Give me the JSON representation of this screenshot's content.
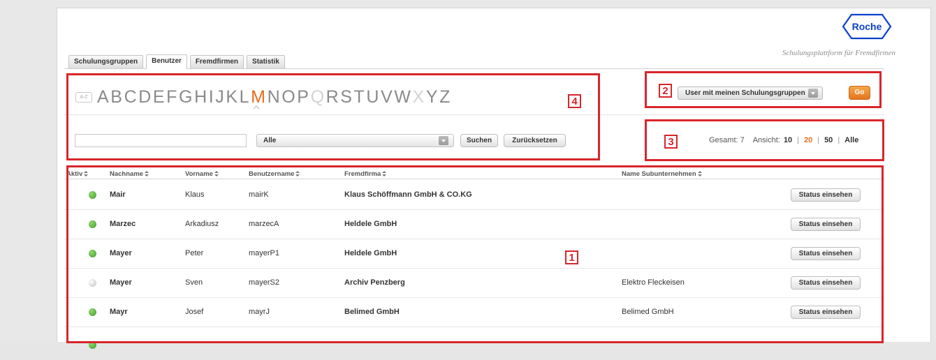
{
  "brand": {
    "logo_text": "Roche",
    "tagline": "Schulungsplattform für Fremdfirmen"
  },
  "tabs": [
    {
      "label": "Schulungsgruppen",
      "active": false
    },
    {
      "label": "Benutzer",
      "active": true
    },
    {
      "label": "Fremdfirmen",
      "active": false
    },
    {
      "label": "Statistik",
      "active": false
    }
  ],
  "alphabet": {
    "icon_label": "A-Z",
    "letters": [
      "A",
      "B",
      "C",
      "D",
      "E",
      "F",
      "G",
      "H",
      "I",
      "J",
      "K",
      "L",
      "M",
      "N",
      "O",
      "P",
      "Q",
      "R",
      "S",
      "T",
      "U",
      "V",
      "W",
      "X",
      "Y",
      "Z"
    ],
    "active": "M",
    "disabled": [
      "Q",
      "X"
    ]
  },
  "search": {
    "input_value": "",
    "filter_selected": "Alle",
    "search_label": "Suchen",
    "reset_label": "Zurücksetzen"
  },
  "user_filter": {
    "selected": "User mit meinen Schulungsgruppen",
    "go_label": "Go"
  },
  "pager": {
    "total_label": "Gesamt:",
    "total": "7",
    "view_label": "Ansicht:",
    "options": [
      "10",
      "20",
      "50",
      "Alle"
    ],
    "selected": "20"
  },
  "table": {
    "headers": [
      "Aktiv",
      "Nachname",
      "Vorname",
      "Benutzername",
      "Fremdfirma",
      "Name Subunternehmen"
    ],
    "rows": [
      {
        "active": true,
        "nachname": "Mair",
        "vorname": "Klaus",
        "benutzername": "mairK",
        "fremdfirma": "Klaus Schöffmann GmbH & CO.KG",
        "sub": "",
        "action": "Status einsehen"
      },
      {
        "active": true,
        "nachname": "Marzec",
        "vorname": "Arkadiusz",
        "benutzername": "marzecA",
        "fremdfirma": "Heldele GmbH",
        "sub": "",
        "action": "Status einsehen"
      },
      {
        "active": true,
        "nachname": "Mayer",
        "vorname": "Peter",
        "benutzername": "mayerP1",
        "fremdfirma": "Heldele GmbH",
        "sub": "",
        "action": "Status einsehen"
      },
      {
        "active": false,
        "nachname": "Mayer",
        "vorname": "Sven",
        "benutzername": "mayerS2",
        "fremdfirma": "Archiv Penzberg",
        "sub": "Elektro Fleckeisen",
        "action": "Status einsehen"
      },
      {
        "active": true,
        "nachname": "Mayr",
        "vorname": "Josef",
        "benutzername": "mayrJ",
        "fremdfirma": "Belimed GmbH",
        "sub": "Belimed GmbH",
        "action": "Status einsehen"
      }
    ]
  },
  "callouts": [
    "1",
    "2",
    "3",
    "4"
  ],
  "colors": {
    "accent": "#e86d1f",
    "callout": "#d8262a",
    "active_dot": "#4caf3a",
    "inactive_dot": "#c8c8c8",
    "logo_blue": "#0b41cd"
  }
}
